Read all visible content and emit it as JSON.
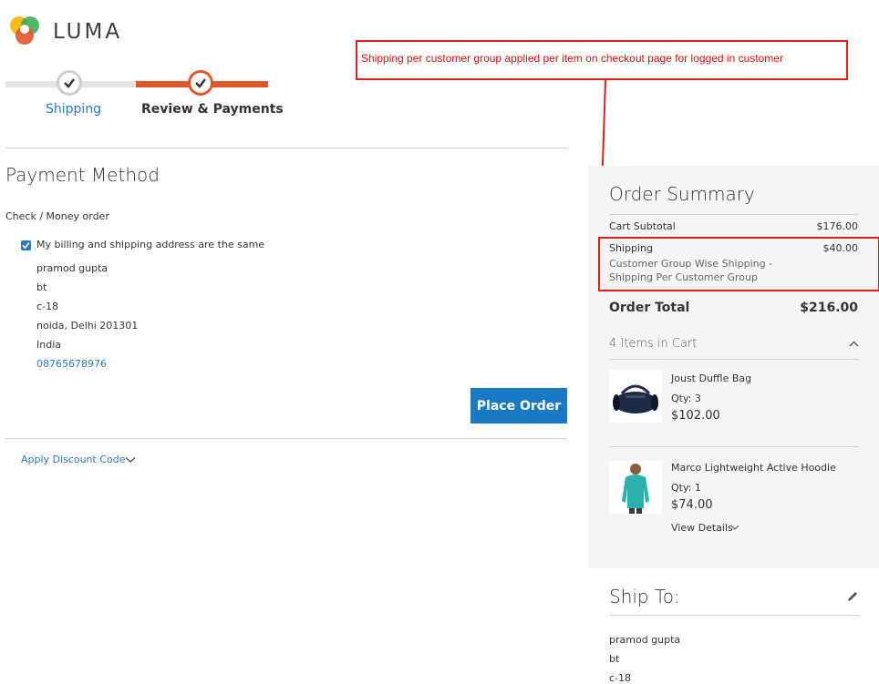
{
  "brand": {
    "name": "LUMA",
    "colors": {
      "orange": "#e2572a",
      "yellow": "#f4b400",
      "green": "#34a853",
      "blue": "#1979c3"
    }
  },
  "progress": {
    "steps": [
      {
        "label": "Shipping",
        "state": "complete"
      },
      {
        "label": "Review & Payments",
        "state": "active"
      }
    ]
  },
  "payment": {
    "title": "Payment Method",
    "method": "Check / Money order",
    "same_address_label": "My billing and shipping address are the same",
    "same_address_checked": true,
    "address": {
      "name": "pramod gupta",
      "company": "bt",
      "street": "c-18",
      "city_line": "noida, Delhi 201301",
      "country": "India",
      "phone": "08765678976"
    },
    "place_order_label": "Place Order",
    "discount_label": "Apply Discount Code"
  },
  "annotation": {
    "text": "Shipping per customer group applied per item on checkout page for logged in customer",
    "color": "#e21b1b"
  },
  "summary": {
    "title": "Order Summary",
    "subtotal_label": "Cart Subtotal",
    "subtotal_value": "$176.00",
    "shipping_label": "Shipping",
    "shipping_method": "Customer Group Wise Shipping - Shipping Per Customer Group",
    "shipping_value": "$40.00",
    "total_label": "Order Total",
    "total_value": "$216.00",
    "items_title": "4 Items in Cart",
    "items": [
      {
        "name": "Joust Duffle Bag",
        "qty": "Qty: 3",
        "price": "$102.00"
      },
      {
        "name": "Marco Lightweight Active Hoodie",
        "qty": "Qty: 1",
        "price": "$74.00"
      }
    ],
    "view_details_label": "View Details"
  },
  "ship_to": {
    "title": "Ship To:",
    "lines": [
      "pramod gupta",
      "bt",
      "c-18"
    ]
  }
}
